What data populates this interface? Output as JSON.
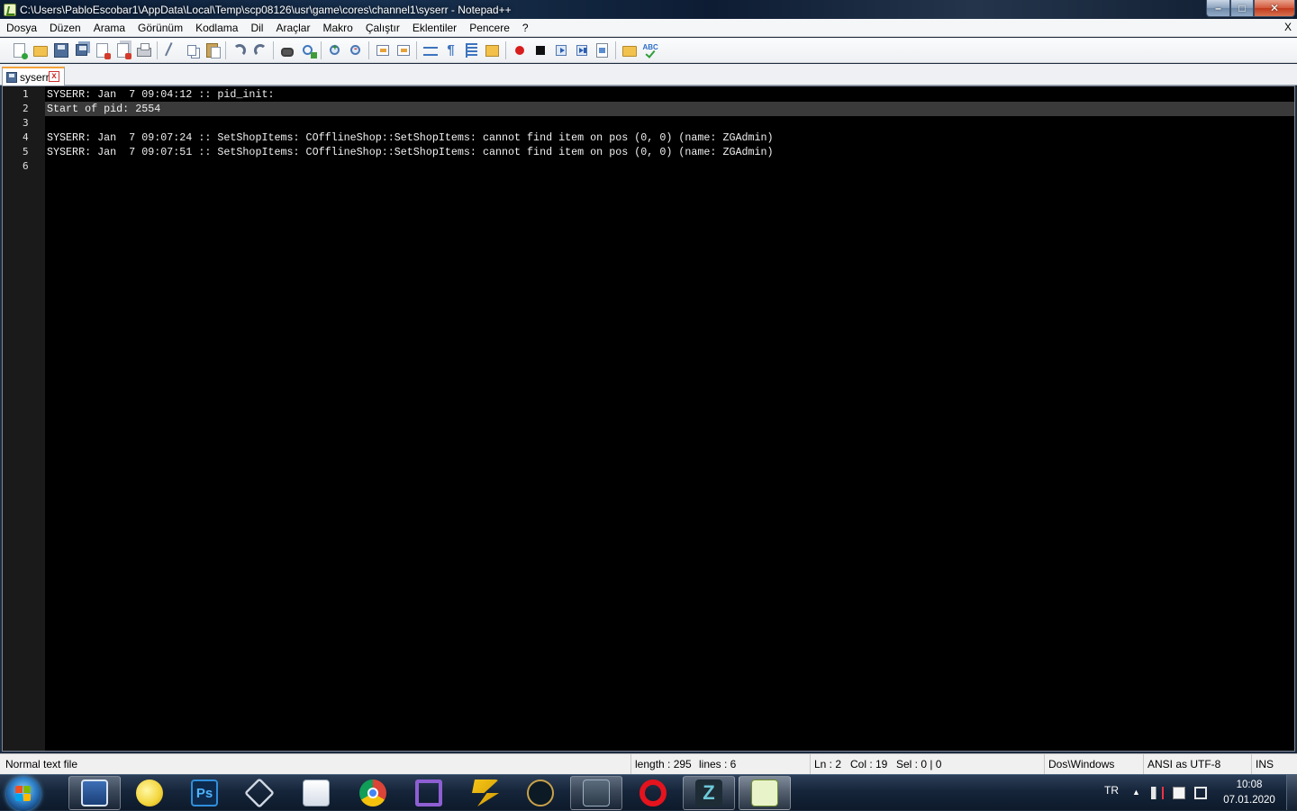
{
  "window": {
    "title": "C:\\Users\\PabloEscobar1\\AppData\\Local\\Temp\\scp08126\\usr\\game\\cores\\channel1\\syserr - Notepad++",
    "btn_minimize": "–",
    "btn_maximize": "□",
    "btn_close": "✕"
  },
  "menu": {
    "items": [
      "Dosya",
      "Düzen",
      "Arama",
      "Görünüm",
      "Kodlama",
      "Dil",
      "Araçlar",
      "Makro",
      "Çalıştır",
      "Eklentiler",
      "Pencere",
      "?"
    ],
    "doc_close": "X"
  },
  "toolbar": {
    "icons": [
      "new-file-icon",
      "open-file-icon",
      "save-icon",
      "save-all-icon",
      "close-icon",
      "close-all-icon",
      "print-icon",
      "cut-icon",
      "copy-icon",
      "paste-icon",
      "undo-icon",
      "redo-icon",
      "find-icon",
      "replace-icon",
      "zoom-in-icon",
      "zoom-out-icon",
      "sync-vertical-icon",
      "sync-horizontal-icon",
      "word-wrap-icon",
      "show-all-chars-icon",
      "indent-guide-icon",
      "user-language-icon",
      "record-macro-icon",
      "stop-macro-icon",
      "play-macro-icon",
      "run-macro-multiple-icon",
      "save-macro-icon",
      "spell-check-icon"
    ]
  },
  "tabs": [
    {
      "label": "syserr",
      "close": "x"
    }
  ],
  "editor": {
    "lines": [
      "SYSERR: Jan  7 09:04:12 :: pid_init: ",
      "Start of pid: 2554",
      "",
      "SYSERR: Jan  7 09:07:24 :: SetShopItems: COfflineShop::SetShopItems: cannot find item on pos (0, 0) (name: ZGAdmin)",
      "SYSERR: Jan  7 09:07:51 :: SetShopItems: COfflineShop::SetShopItems: cannot find item on pos (0, 0) (name: ZGAdmin)",
      ""
    ],
    "line_numbers": [
      "1",
      "2",
      "3",
      "4",
      "5",
      "6"
    ],
    "current_line": 2
  },
  "status": {
    "file_type": "Normal text file",
    "length": "length : 295",
    "lines": "lines : 6",
    "ln": "Ln : 2",
    "col": "Col : 19",
    "sel": "Sel : 0 | 0",
    "eol": "Dos\\Windows",
    "encoding": "ANSI as UTF-8",
    "mode": "INS"
  },
  "taskbar": {
    "apps": [
      "remote-desktop",
      "winscp",
      "photoshop",
      "virtualbox",
      "file-transfer",
      "chrome",
      "visual-studio",
      "zeal",
      "league-of-legends",
      "network-tool",
      "opera",
      "z-app",
      "notepad-plus-plus"
    ],
    "tray_language": "TR",
    "clock_time": "10:08",
    "clock_date": "07.01.2020"
  },
  "colors": {
    "editor_bg": "#000000",
    "editor_text": "#f0f0f0",
    "current_line": "#3a3a3a",
    "tab_accent": "#f6a33a"
  }
}
